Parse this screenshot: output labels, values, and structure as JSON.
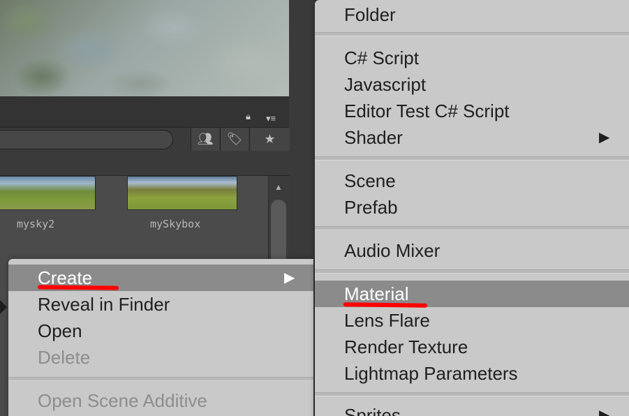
{
  "assets": {
    "thumbnails": [
      {
        "label": "mysky2"
      },
      {
        "label": "mySkybox"
      }
    ]
  },
  "toolbar": {
    "icons": [
      "lock-icon",
      "menu-lines-icon",
      "people-icon",
      "tag-icon",
      "star-icon",
      "scroll-up-icon"
    ]
  },
  "context_menu": {
    "items": [
      {
        "label": "Create",
        "submenu": true,
        "highlighted": true,
        "arrow": "▶"
      },
      {
        "label": "Reveal in Finder"
      },
      {
        "label": "Open"
      },
      {
        "label": "Delete",
        "disabled": true
      },
      {
        "label": "Open Scene Additive",
        "disabled": true
      }
    ]
  },
  "create_submenu": {
    "items": [
      {
        "label": "Folder"
      },
      {
        "label": "C# Script"
      },
      {
        "label": "Javascript"
      },
      {
        "label": "Editor Test C# Script"
      },
      {
        "label": "Shader",
        "submenu": true,
        "arrow": "▶"
      },
      {
        "label": "Scene"
      },
      {
        "label": "Prefab"
      },
      {
        "label": "Audio Mixer"
      },
      {
        "label": "Material",
        "highlighted": true
      },
      {
        "label": "Lens Flare"
      },
      {
        "label": "Render Texture"
      },
      {
        "label": "Lightmap Parameters"
      },
      {
        "label": "Sprites",
        "submenu": true,
        "arrow": "▶"
      }
    ]
  },
  "annotations": {
    "underline_color": "#ff0000"
  }
}
